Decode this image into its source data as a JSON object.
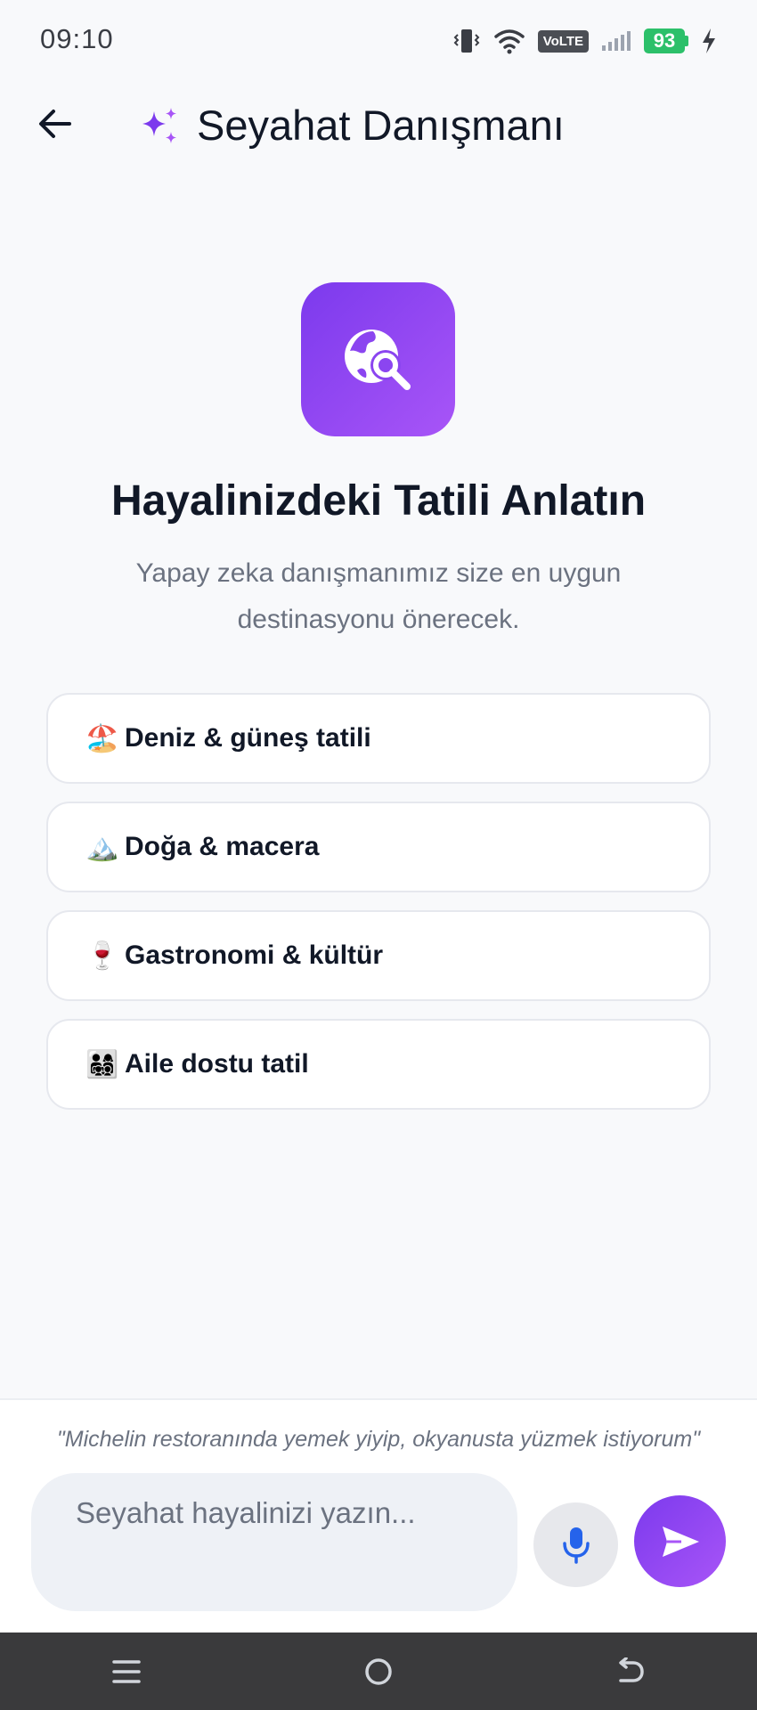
{
  "status_bar": {
    "time": "09:10",
    "network_badge": "VoLTE",
    "battery": "93"
  },
  "app_bar": {
    "title": "Seyahat Danışmanı"
  },
  "hero": {
    "title": "Hayalinizdeki Tatili Anlatın",
    "subtitle": "Yapay zeka danışmanımız size en uygun destinasyonu önerecek."
  },
  "suggestions": [
    {
      "emoji": "🏖️",
      "label": "Deniz & güneş tatili"
    },
    {
      "emoji": "🏔️",
      "label": "Doğa & macera"
    },
    {
      "emoji": "🍷",
      "label": "Gastronomi & kültür"
    },
    {
      "emoji": "👨‍👩‍👧‍👦",
      "label": "Aile dostu tatil"
    }
  ],
  "composer": {
    "hint": "\"Michelin restoranında yemek yiyip, okyanusta yüzmek istiyorum\"",
    "placeholder": "Seyahat hayalinizi yazın...",
    "value": ""
  },
  "colors": {
    "accent": "#7c3aed",
    "accent_light": "#a855f7",
    "mic_icon": "#2563eb",
    "battery": "#2cc06a"
  },
  "icons": {
    "back": "arrow-left-icon",
    "title": "sparkles-icon",
    "hero": "globe-search-icon",
    "mic": "microphone-icon",
    "send": "send-icon",
    "nav": [
      "menu-icon",
      "home-icon",
      "back-icon"
    ]
  }
}
